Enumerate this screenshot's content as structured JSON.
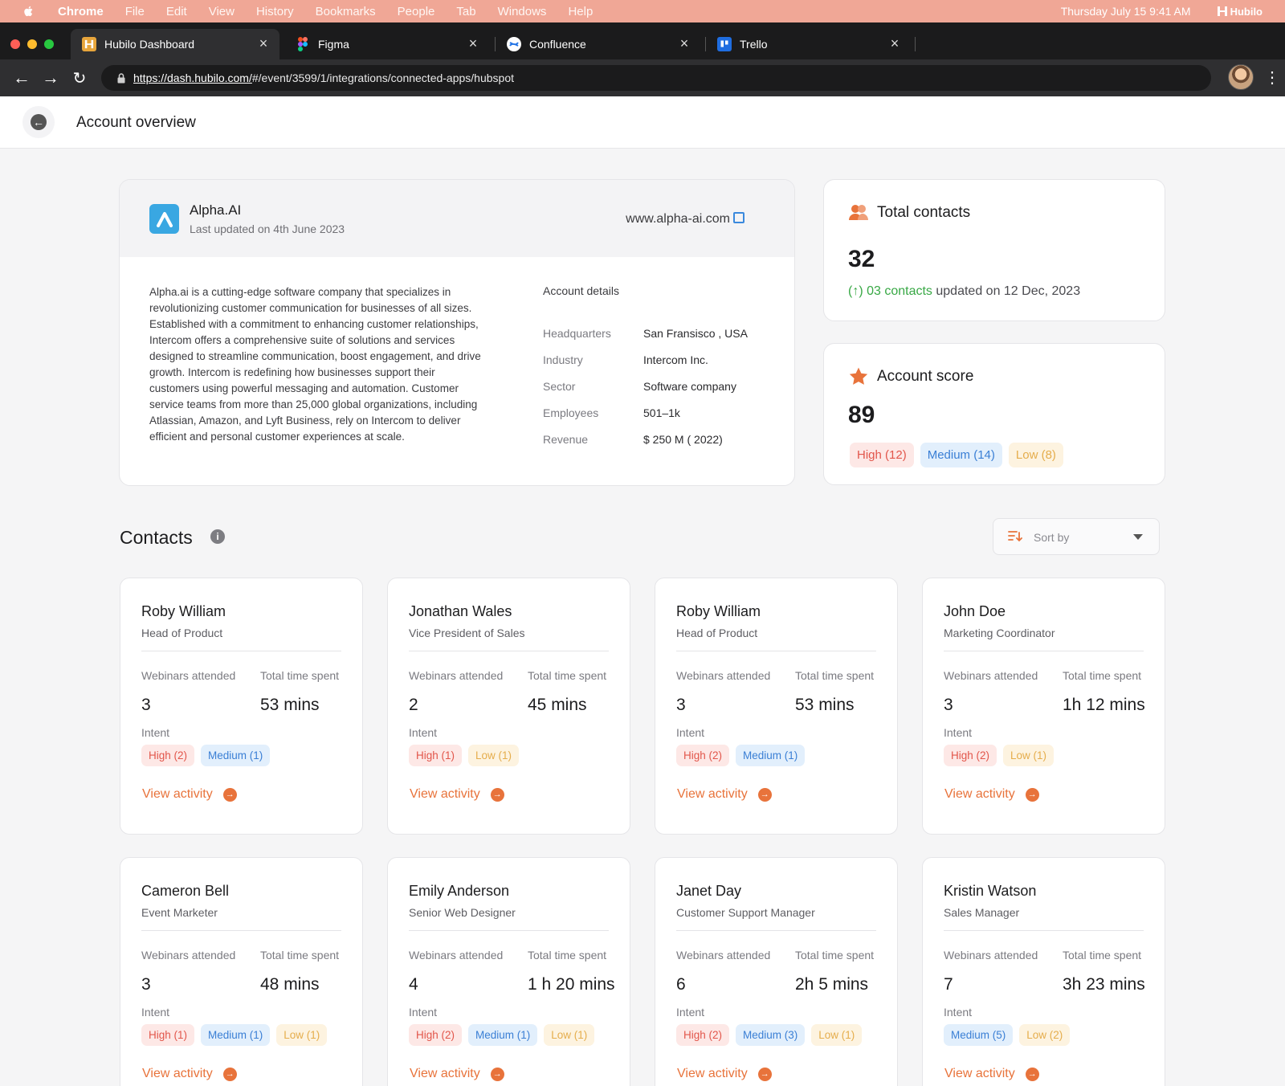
{
  "menubar": {
    "app": "Chrome",
    "items": [
      "File",
      "Edit",
      "View",
      "History",
      "Bookmarks",
      "People",
      "Tab",
      "Windows",
      "Help"
    ],
    "clock": "Thursday July 15  9:41 AM",
    "brand": "Hubilo"
  },
  "tabs": [
    {
      "label": "Hubilo Dashboard",
      "icon": "hubilo-icon"
    },
    {
      "label": "Figma",
      "icon": "figma-icon"
    },
    {
      "label": "Confluence",
      "icon": "confluence-icon"
    },
    {
      "label": "Trello",
      "icon": "trello-icon"
    }
  ],
  "url": {
    "host": "https://dash.hubilo.com/",
    "path": "#/event/3599/1/integrations/connected-apps/hubspot"
  },
  "page": {
    "title": "Account overview"
  },
  "company": {
    "name": "Alpha.AI",
    "updated": "Last updated on 4th June 2023",
    "website": "www.alpha-ai.com",
    "description": "Alpha.ai is a cutting-edge software company that specializes in revolutionizing customer communication for businesses of all sizes. Established with a commitment to enhancing customer relationships, Intercom offers a comprehensive suite of solutions and services designed to streamline communication, boost engagement, and drive growth. Intercom is redefining how businesses support their customers using powerful messaging and automation. Customer service teams from more than 25,000 global organizations, including Atlassian, Amazon, and Lyft Business, rely on Intercom to deliver efficient and personal customer experiences at scale.",
    "details_title": "Account details",
    "details": [
      {
        "k": "Headquarters",
        "v": "San Fransisco , USA"
      },
      {
        "k": "Industry",
        "v": "Intercom Inc."
      },
      {
        "k": "Sector",
        "v": "Software company"
      },
      {
        "k": "Employees",
        "v": "501–1k"
      },
      {
        "k": "Revenue",
        "v": "$ 250 M ( 2022)"
      }
    ]
  },
  "total_contacts": {
    "title": "Total contacts",
    "value": "32",
    "delta": "(↑) 03 contacts",
    "updated": " updated on 12 Dec, 2023"
  },
  "account_score": {
    "title": "Account score",
    "value": "89",
    "high": "High (12)",
    "medium": "Medium (14)",
    "low": "Low (8)"
  },
  "contacts": {
    "title": "Contacts",
    "sort_label": "Sort by",
    "webinars_label": "Webinars attended",
    "time_label": "Total time spent",
    "intent_label": "Intent",
    "view_label": "View activity",
    "people": [
      {
        "name": "Roby William",
        "role": "Head of Product",
        "webinars": "3",
        "time": "53 mins",
        "tags": [
          {
            "t": "high",
            "l": "High (2)"
          },
          {
            "t": "medium",
            "l": "Medium (1)"
          }
        ]
      },
      {
        "name": "Jonathan Wales",
        "role": "Vice President of Sales",
        "webinars": "2",
        "time": "45 mins",
        "tags": [
          {
            "t": "high",
            "l": "High (1)"
          },
          {
            "t": "low",
            "l": "Low (1)"
          }
        ]
      },
      {
        "name": "Roby William",
        "role": "Head of Product",
        "webinars": "3",
        "time": "53 mins",
        "tags": [
          {
            "t": "high",
            "l": "High (2)"
          },
          {
            "t": "medium",
            "l": "Medium (1)"
          }
        ]
      },
      {
        "name": "John Doe",
        "role": "Marketing Coordinator",
        "webinars": "3",
        "time": "1h 12 mins",
        "tags": [
          {
            "t": "high",
            "l": "High (2)"
          },
          {
            "t": "low",
            "l": "Low (1)"
          }
        ]
      },
      {
        "name": "Cameron Bell",
        "role": "Event Marketer",
        "webinars": "3",
        "time": "48 mins",
        "tags": [
          {
            "t": "high",
            "l": "High (1)"
          },
          {
            "t": "medium",
            "l": "Medium (1)"
          },
          {
            "t": "low",
            "l": "Low (1)"
          }
        ]
      },
      {
        "name": "Emily Anderson",
        "role": "Senior Web Designer",
        "webinars": "4",
        "time": "1 h 20 mins",
        "tags": [
          {
            "t": "high",
            "l": "High (2)"
          },
          {
            "t": "medium",
            "l": "Medium (1)"
          },
          {
            "t": "low",
            "l": "Low (1)"
          }
        ]
      },
      {
        "name": "Janet Day",
        "role": "Customer Support Manager",
        "webinars": "6",
        "time": "2h 5 mins",
        "tags": [
          {
            "t": "high",
            "l": "High (2)"
          },
          {
            "t": "medium",
            "l": "Medium (3)"
          },
          {
            "t": "low",
            "l": "Low (1)"
          }
        ]
      },
      {
        "name": "Kristin Watson",
        "role": "Sales Manager",
        "webinars": "7",
        "time": "3h 23 mins",
        "tags": [
          {
            "t": "medium",
            "l": "Medium (5)"
          },
          {
            "t": "low",
            "l": "Low (2)"
          }
        ]
      }
    ]
  },
  "colors": {
    "menubar": "#f0a796",
    "accent": "#e8733b",
    "high": "#e2564b",
    "medium": "#3a7fd5",
    "low": "#e5ad4c",
    "delta": "#38a845"
  }
}
